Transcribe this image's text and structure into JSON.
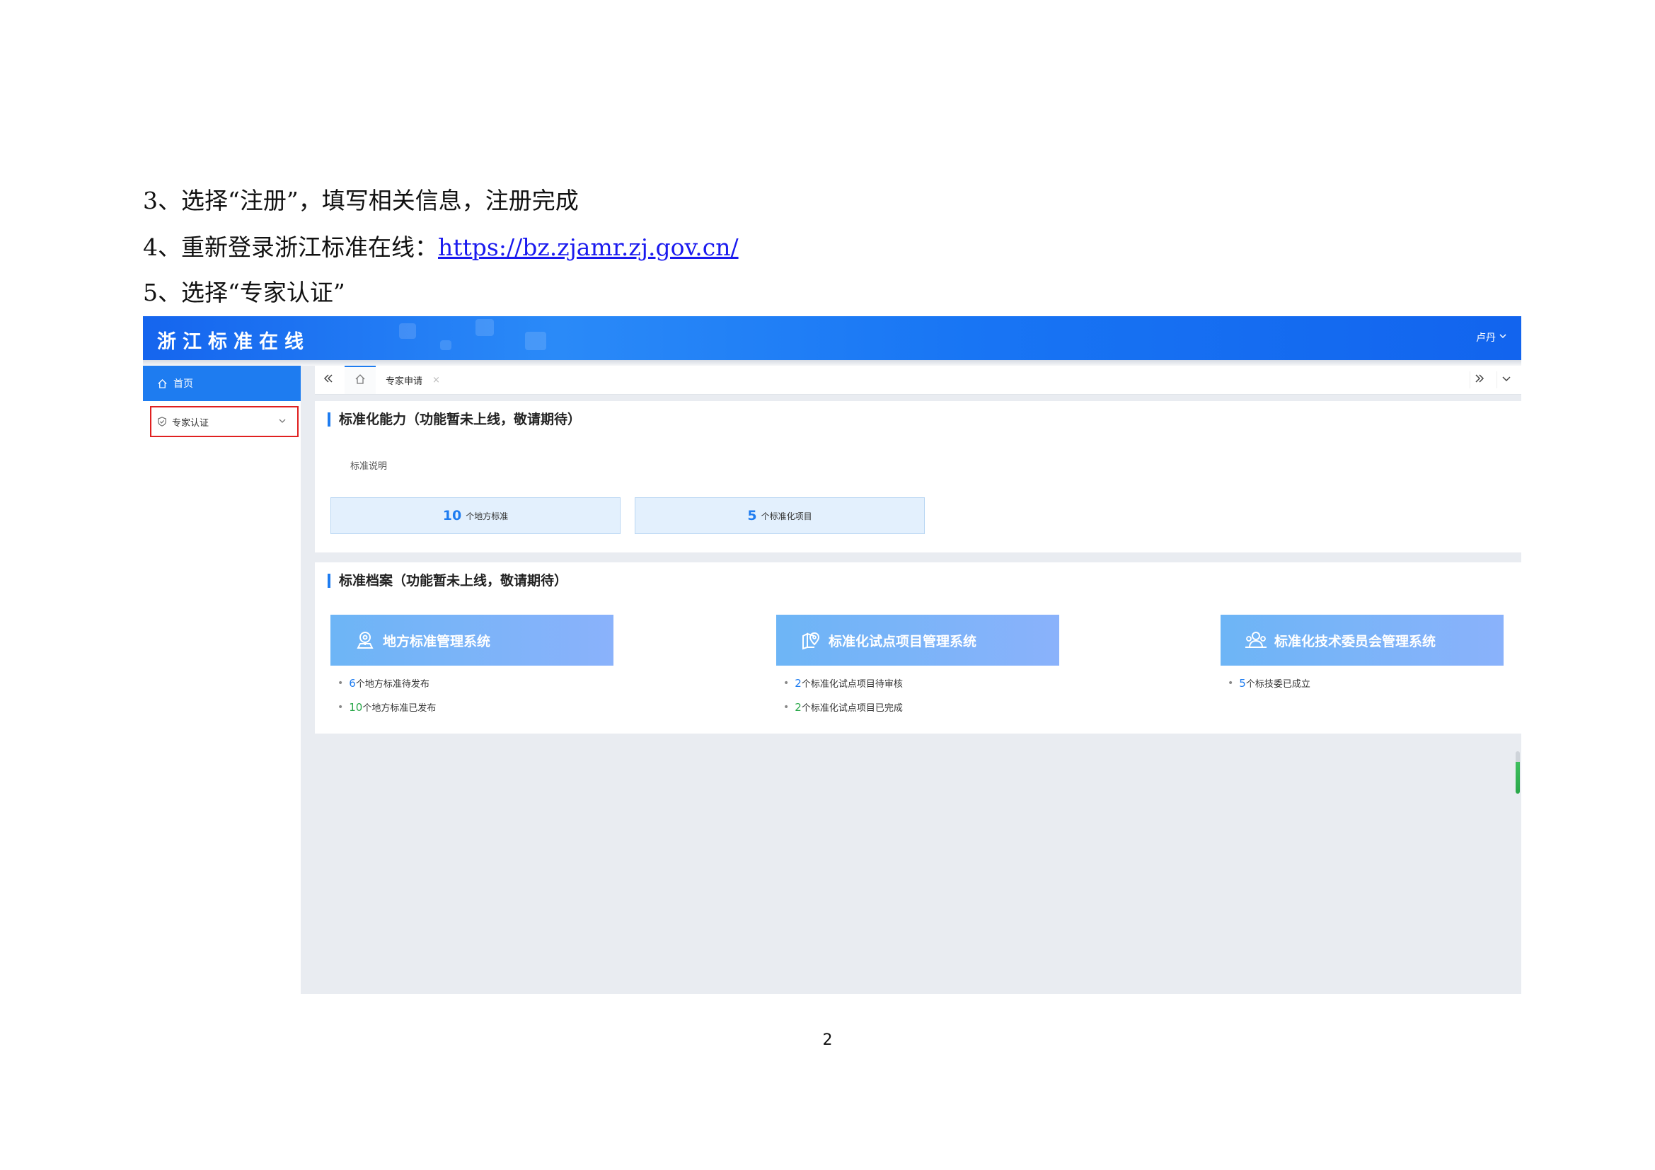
{
  "document": {
    "step3": "3、选择“注册”，填写相关信息，注册完成",
    "step4_prefix": "4、重新登录浙江标准在线：",
    "step4_link": "https://bz.zjamr.zj.gov.cn/",
    "step5": "5、选择“专家认证”",
    "page_number": "2"
  },
  "app": {
    "title": "浙江标准在线",
    "user": "卢丹"
  },
  "sidebar": {
    "home_label": "首页",
    "expert_label": "专家认证"
  },
  "tabs": {
    "active_label": "专家申请"
  },
  "capability_panel": {
    "title": "标准化能力（功能暂未上线，敬请期待）",
    "description": "标准说明",
    "stats": [
      {
        "value": "10",
        "label": "个地方标准"
      },
      {
        "value": "5",
        "label": "个标准化项目"
      }
    ]
  },
  "archive_panel": {
    "title": "标准档案（功能暂未上线，敬请期待）",
    "systems": [
      {
        "name": "地方标准管理系统",
        "icon": "location-pin-icon",
        "lines": [
          {
            "value": "6",
            "label": "个地方标准待发布",
            "color": "#1e7cf0"
          },
          {
            "value": "10",
            "label": "个地方标准已发布",
            "color": "#2aa84a"
          }
        ]
      },
      {
        "name": "标准化试点项目管理系统",
        "icon": "map-pin-icon",
        "lines": [
          {
            "value": "2",
            "label": "个标准化试点项目待审核",
            "color": "#1e7cf0"
          },
          {
            "value": "2",
            "label": "个标准化试点项目已完成",
            "color": "#2aa84a"
          }
        ]
      },
      {
        "name": "标准化技术委员会管理系统",
        "icon": "users-icon",
        "lines": [
          {
            "value": "5",
            "label": "个标技委已成立",
            "color": "#1e7cf0"
          }
        ]
      }
    ]
  }
}
